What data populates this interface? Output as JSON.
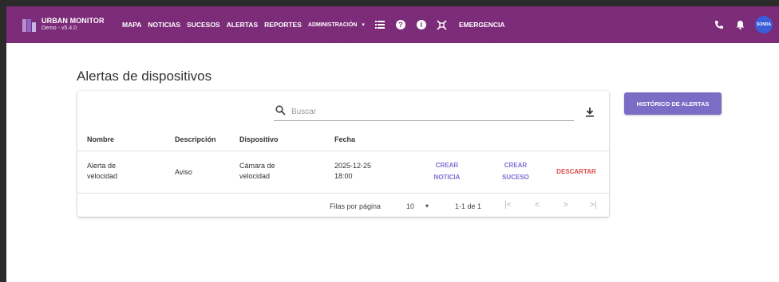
{
  "brand": {
    "name": "URBAN MONITOR",
    "version": "Demo - v5.4.0"
  },
  "nav": {
    "items": [
      "MAPA",
      "NOTICIAS",
      "SUCESOS",
      "ALERTAS",
      "REPORTES"
    ],
    "admin": "ADMINISTRACIÓN",
    "caret": "▾",
    "help_icon": "?",
    "info_icon": "i",
    "emergency": "EMERGENCIA",
    "icons": [
      "list-icon",
      "help-icon",
      "info-icon",
      "emergency-icon",
      "phone-icon",
      "bell-icon"
    ]
  },
  "user": {
    "avatar_text": "SONDA",
    "avatar_color": "#3a5ed8"
  },
  "page": {
    "title": "Alertas de dispositivos"
  },
  "search": {
    "placeholder": "Buscar",
    "value": ""
  },
  "table": {
    "headers": [
      "Nombre",
      "Descripción",
      "Dispositivo",
      "Fecha"
    ],
    "rows": [
      {
        "nombre": [
          "Alerta de",
          "velocidad"
        ],
        "descripcion": "Aviso",
        "dispositivo": [
          "Cámara de",
          "velocidad"
        ],
        "fecha": [
          "2025-12-25",
          "18:00"
        ],
        "actions": {
          "crear_noticia": [
            "CREAR",
            "NOTICIA"
          ],
          "crear_suceso": [
            "CREAR",
            "SUCESO"
          ],
          "descartar": "DESCARTAR"
        }
      }
    ]
  },
  "pagination": {
    "rows_label": "Filas por página",
    "rows_value": "10",
    "caret": "▾",
    "range": "1-1 de 1",
    "first": "|<",
    "prev": "<",
    "next": ">",
    "last": ">|"
  },
  "buttons": {
    "historico": "HISTÓRICO DE ALERTAS"
  },
  "colors": {
    "topbar": "#7b2a78",
    "accent": "#7b6cc6",
    "action_link": "#7d6fd6",
    "danger": "#e04949"
  }
}
